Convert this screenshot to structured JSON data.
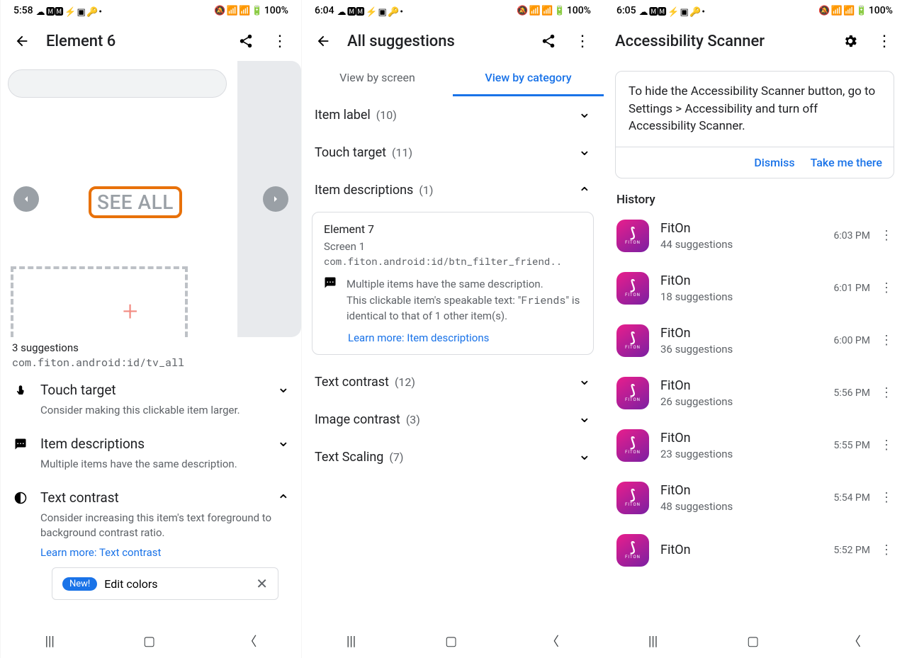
{
  "status": {
    "battery": "100%",
    "icons_left": "☁ 🅼🅼 ⚡ ▣ 🔑 •",
    "icons_right": "🔕 📶 📶 🔋"
  },
  "phone1": {
    "time": "5:58",
    "title": "Element 6",
    "see_all": "SEE ALL",
    "suggestions_count": "3 suggestions",
    "resource_id": "com.fiton.android:id/tv_all",
    "items": [
      {
        "title": "Touch target",
        "desc": "Consider making this clickable item larger.",
        "expanded": false
      },
      {
        "title": "Item descriptions",
        "desc": "Multiple items have the same description.",
        "expanded": false
      },
      {
        "title": "Text contrast",
        "desc": "Consider increasing this item's text foreground to background contrast ratio.",
        "expanded": true
      }
    ],
    "learn_more": "Learn more: Text contrast",
    "new_badge": "New!",
    "edit_colors": "Edit colors"
  },
  "phone2": {
    "time": "6:04",
    "title": "All suggestions",
    "tabs": [
      "View by screen",
      "View by category"
    ],
    "categories": [
      {
        "name": "Item label",
        "count": "(10)",
        "expanded": false
      },
      {
        "name": "Touch target",
        "count": "(11)",
        "expanded": false
      },
      {
        "name": "Item descriptions",
        "count": "(1)",
        "expanded": true
      },
      {
        "name": "Text contrast",
        "count": "(12)",
        "expanded": false
      },
      {
        "name": "Image contrast",
        "count": "(3)",
        "expanded": false
      },
      {
        "name": "Text Scaling",
        "count": "(7)",
        "expanded": false
      }
    ],
    "detail": {
      "element": "Element 7",
      "screen": "Screen 1",
      "resource_id": "com.fiton.android:id/btn_filter_friend..",
      "line1": "Multiple items have the same description.",
      "line2a": "This clickable item's speakable text: \"",
      "line2b": "Friends",
      "line2c": "\" is identical to that of 1 other item(s).",
      "learn_more": "Learn more: Item descriptions"
    }
  },
  "phone3": {
    "time": "6:05",
    "title": "Accessibility Scanner",
    "info": "To hide the Accessibility Scanner button, go to Settings > Accessibility and turn off Accessibility Scanner.",
    "dismiss": "Dismiss",
    "take_me": "Take me there",
    "history_label": "History",
    "history": [
      {
        "name": "FitOn",
        "sub": "44 suggestions",
        "time": "6:03 PM"
      },
      {
        "name": "FitOn",
        "sub": "18 suggestions",
        "time": "6:01 PM"
      },
      {
        "name": "FitOn",
        "sub": "36 suggestions",
        "time": "6:00 PM"
      },
      {
        "name": "FitOn",
        "sub": "26 suggestions",
        "time": "5:56 PM"
      },
      {
        "name": "FitOn",
        "sub": "23 suggestions",
        "time": "5:55 PM"
      },
      {
        "name": "FitOn",
        "sub": "48 suggestions",
        "time": "5:54 PM"
      },
      {
        "name": "FitOn",
        "sub": "",
        "time": "5:52 PM"
      }
    ],
    "app_icon_label": "FITON"
  }
}
